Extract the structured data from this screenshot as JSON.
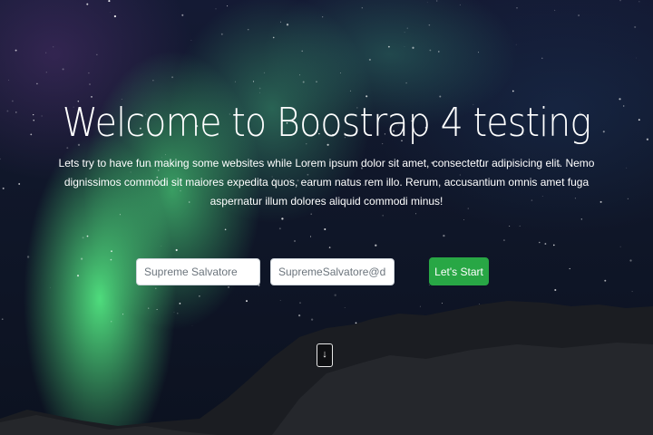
{
  "hero": {
    "title": "Welcome to Boostrap 4 testing",
    "lead": "Lets try to have fun making some websites while Lorem ipsum dolor sit amet, consectetur adipisicing elit. Nemo dignissimos commodi sit maiores expedita quos, earum natus rem illo. Rerum, accusantium omnis amet fuga aspernatur illum dolores aliquid commodi minus!"
  },
  "form": {
    "name_placeholder": "Supreme Salvatore",
    "email_placeholder": "SupremeSalvatore@dummy.com",
    "submit_label": "Let's Start"
  },
  "scroll": {
    "label": "↓",
    "icon": "arrow-down-icon"
  },
  "colors": {
    "accent": "#28a745",
    "aurora": "#5aff8c",
    "sky": "#10172a"
  }
}
